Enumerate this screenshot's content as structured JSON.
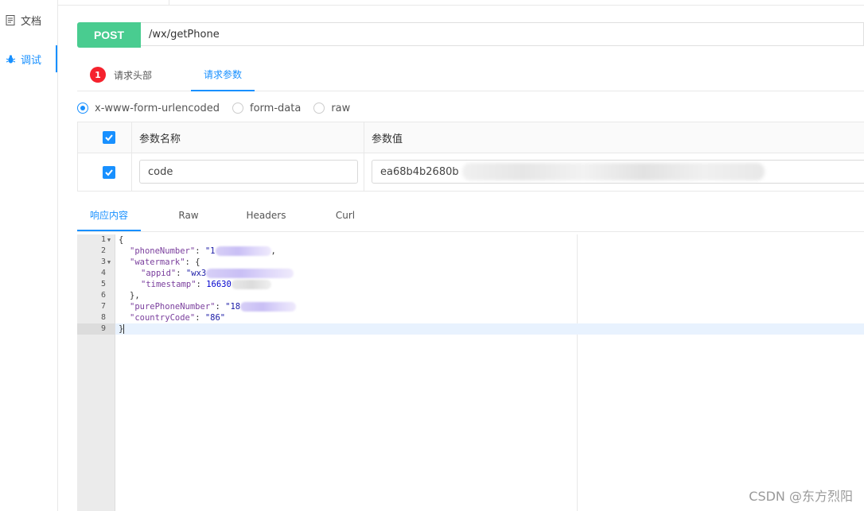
{
  "sidebar": {
    "items": [
      {
        "label": "文档",
        "icon": "document-icon"
      },
      {
        "label": "调试",
        "icon": "bug-icon"
      }
    ]
  },
  "request": {
    "method": "POST",
    "url": "/wx/getPhone",
    "tabs": {
      "headers_badge": "1",
      "headers_label": "请求头部",
      "params_label": "请求参数"
    },
    "body_types": [
      "x-www-form-urlencoded",
      "form-data",
      "raw"
    ],
    "selected_body_type": "x-www-form-urlencoded",
    "params_table": {
      "col_name": "参数名称",
      "col_value": "参数值",
      "rows": [
        {
          "name": "code",
          "value": "ea68b4b2680b",
          "checked": true
        }
      ]
    }
  },
  "response": {
    "tabs": [
      "响应内容",
      "Raw",
      "Headers",
      "Curl"
    ],
    "active_tab": "响应内容",
    "line_numbers": [
      "1",
      "2",
      "3",
      "4",
      "5",
      "6",
      "7",
      "8",
      "9"
    ],
    "code": {
      "l1": "{",
      "l2_key": "\"phoneNumber\"",
      "l2_val": "\"1",
      "l3_key": "\"watermark\"",
      "l3_rest": ": {",
      "l4_key": "\"appid\"",
      "l4_val": "\"wx3",
      "l5_key": "\"timestamp\"",
      "l5_val": "16630",
      "l6": "},",
      "l7_key": "\"purePhoneNumber\"",
      "l7_val": "\"18",
      "l8_key": "\"countryCode\"",
      "l8_val": "\"86\"",
      "l9": "}"
    }
  },
  "watermark": "CSDN @东方烈阳",
  "colors": {
    "accent": "#1890ff",
    "method_post": "#49cc90",
    "badge": "#f5222d"
  }
}
